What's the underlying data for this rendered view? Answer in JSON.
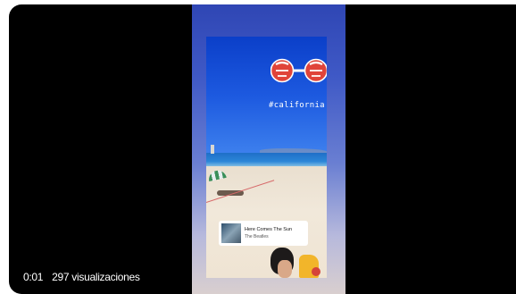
{
  "video": {
    "elapsed_time": "0:01",
    "view_count": "297 visualizaciones"
  },
  "story": {
    "sticker_text": "CALIFORNIA",
    "hashtag": "#california",
    "music": {
      "song_title": "Here Comes The Sun",
      "artist": "The Beatles"
    }
  },
  "colors": {
    "player_background": "#000000",
    "frame_gradient_top": "#2f46b4",
    "sticker_red": "#e0443a"
  }
}
